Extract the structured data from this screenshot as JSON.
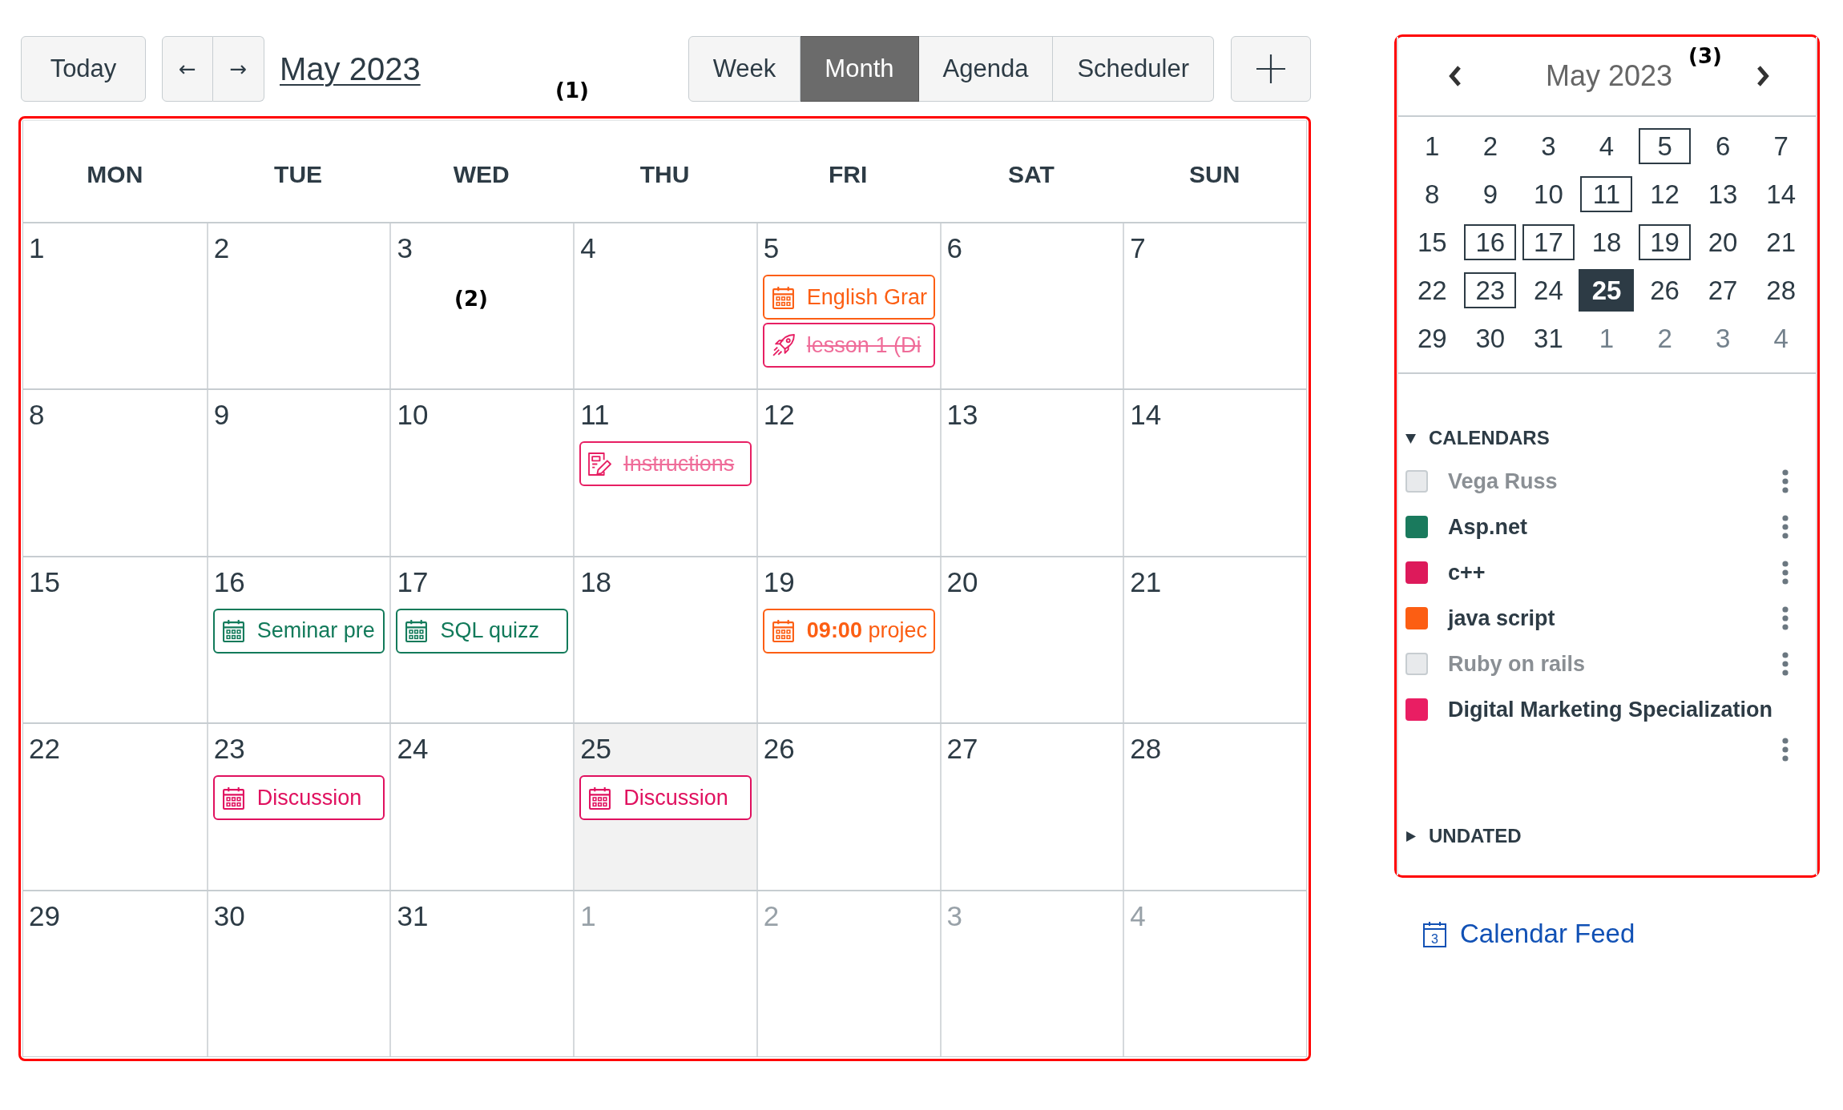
{
  "toolbar": {
    "today_button": "Today",
    "prev_button": "←",
    "next_button": "→",
    "title": "May 2023",
    "views": [
      {
        "label": "Week",
        "selected": false
      },
      {
        "label": "Month",
        "selected": true
      },
      {
        "label": "Agenda",
        "selected": false
      },
      {
        "label": "Scheduler",
        "selected": false
      }
    ]
  },
  "month_grid": {
    "weekdays": [
      "MON",
      "TUE",
      "WED",
      "THU",
      "FRI",
      "SAT",
      "SUN"
    ],
    "weeks": [
      [
        {
          "day": "1",
          "outside_month": false,
          "today": false
        },
        {
          "day": "2",
          "outside_month": false,
          "today": false
        },
        {
          "day": "3",
          "outside_month": false,
          "today": false
        },
        {
          "day": "4",
          "outside_month": false,
          "today": false
        },
        {
          "day": "5",
          "outside_month": false,
          "today": false,
          "events": [
            {
              "kind": "event",
              "title": "English Grar",
              "color": "#fc5e13",
              "completed": false
            },
            {
              "kind": "quiz",
              "title": "lesson 1 (Di",
              "color": "#e71f63",
              "completed": true
            }
          ]
        },
        {
          "day": "6",
          "outside_month": false,
          "today": false
        },
        {
          "day": "7",
          "outside_month": false,
          "today": false
        }
      ],
      [
        {
          "day": "8",
          "outside_month": false,
          "today": false
        },
        {
          "day": "9",
          "outside_month": false,
          "today": false
        },
        {
          "day": "10",
          "outside_month": false,
          "today": false
        },
        {
          "day": "11",
          "outside_month": false,
          "today": false,
          "events": [
            {
              "kind": "assignment",
              "title": "Instructions",
              "color": "#e71f63",
              "completed": true
            }
          ]
        },
        {
          "day": "12",
          "outside_month": false,
          "today": false
        },
        {
          "day": "13",
          "outside_month": false,
          "today": false
        },
        {
          "day": "14",
          "outside_month": false,
          "today": false
        }
      ],
      [
        {
          "day": "15",
          "outside_month": false,
          "today": false
        },
        {
          "day": "16",
          "outside_month": false,
          "today": false,
          "events": [
            {
              "kind": "event",
              "title": "Seminar pre",
              "color": "#127a5a",
              "completed": false
            }
          ]
        },
        {
          "day": "17",
          "outside_month": false,
          "today": false,
          "events": [
            {
              "kind": "event",
              "title": "SQL quizz",
              "color": "#127a5a",
              "completed": false
            }
          ]
        },
        {
          "day": "18",
          "outside_month": false,
          "today": false
        },
        {
          "day": "19",
          "outside_month": false,
          "today": false,
          "events": [
            {
              "kind": "event",
              "title": "**09:00** projec",
              "color": "#fc5e13",
              "completed": false
            }
          ]
        },
        {
          "day": "20",
          "outside_month": false,
          "today": false
        },
        {
          "day": "21",
          "outside_month": false,
          "today": false
        }
      ],
      [
        {
          "day": "22",
          "outside_month": false,
          "today": false
        },
        {
          "day": "23",
          "outside_month": false,
          "today": false,
          "events": [
            {
              "kind": "event",
              "title": "Discussion",
              "color": "#e0115f",
              "completed": false
            }
          ]
        },
        {
          "day": "24",
          "outside_month": false,
          "today": false
        },
        {
          "day": "25",
          "outside_month": false,
          "today": true,
          "events": [
            {
              "kind": "event",
              "title": "Discussion",
              "color": "#e0115f",
              "completed": false
            }
          ]
        },
        {
          "day": "26",
          "outside_month": false,
          "today": false
        },
        {
          "day": "27",
          "outside_month": false,
          "today": false
        },
        {
          "day": "28",
          "outside_month": false,
          "today": false
        }
      ],
      [
        {
          "day": "29",
          "outside_month": false,
          "today": false
        },
        {
          "day": "30",
          "outside_month": false,
          "today": false
        },
        {
          "day": "31",
          "outside_month": false,
          "today": false
        },
        {
          "day": "1",
          "outside_month": true,
          "today": false
        },
        {
          "day": "2",
          "outside_month": true,
          "today": false
        },
        {
          "day": "3",
          "outside_month": true,
          "today": false
        },
        {
          "day": "4",
          "outside_month": true,
          "today": false
        }
      ]
    ]
  },
  "mini_calendar": {
    "title": "May 2023",
    "days": [
      {
        "day": "1",
        "selected": false,
        "has_events": false,
        "outside_month": false
      },
      {
        "day": "2",
        "selected": false,
        "has_events": false,
        "outside_month": false
      },
      {
        "day": "3",
        "selected": false,
        "has_events": false,
        "outside_month": false
      },
      {
        "day": "4",
        "selected": false,
        "has_events": false,
        "outside_month": false
      },
      {
        "day": "5",
        "selected": false,
        "has_events": true,
        "outside_month": false
      },
      {
        "day": "6",
        "selected": false,
        "has_events": false,
        "outside_month": false
      },
      {
        "day": "7",
        "selected": false,
        "has_events": false,
        "outside_month": false
      },
      {
        "day": "8",
        "selected": false,
        "has_events": false,
        "outside_month": false
      },
      {
        "day": "9",
        "selected": false,
        "has_events": false,
        "outside_month": false
      },
      {
        "day": "10",
        "selected": false,
        "has_events": false,
        "outside_month": false
      },
      {
        "day": "11",
        "selected": false,
        "has_events": true,
        "outside_month": false
      },
      {
        "day": "12",
        "selected": false,
        "has_events": false,
        "outside_month": false
      },
      {
        "day": "13",
        "selected": false,
        "has_events": false,
        "outside_month": false
      },
      {
        "day": "14",
        "selected": false,
        "has_events": false,
        "outside_month": false
      },
      {
        "day": "15",
        "selected": false,
        "has_events": false,
        "outside_month": false
      },
      {
        "day": "16",
        "selected": false,
        "has_events": true,
        "outside_month": false
      },
      {
        "day": "17",
        "selected": false,
        "has_events": true,
        "outside_month": false
      },
      {
        "day": "18",
        "selected": false,
        "has_events": false,
        "outside_month": false
      },
      {
        "day": "19",
        "selected": false,
        "has_events": true,
        "outside_month": false
      },
      {
        "day": "20",
        "selected": false,
        "has_events": false,
        "outside_month": false
      },
      {
        "day": "21",
        "selected": false,
        "has_events": false,
        "outside_month": false
      },
      {
        "day": "22",
        "selected": false,
        "has_events": false,
        "outside_month": false
      },
      {
        "day": "23",
        "selected": false,
        "has_events": true,
        "outside_month": false
      },
      {
        "day": "24",
        "selected": false,
        "has_events": false,
        "outside_month": false
      },
      {
        "day": "25",
        "selected": true,
        "has_events": false,
        "outside_month": false
      },
      {
        "day": "26",
        "selected": false,
        "has_events": false,
        "outside_month": false
      },
      {
        "day": "27",
        "selected": false,
        "has_events": false,
        "outside_month": false
      },
      {
        "day": "28",
        "selected": false,
        "has_events": false,
        "outside_month": false
      },
      {
        "day": "29",
        "selected": false,
        "has_events": false,
        "outside_month": false
      },
      {
        "day": "30",
        "selected": false,
        "has_events": false,
        "outside_month": false
      },
      {
        "day": "31",
        "selected": false,
        "has_events": false,
        "outside_month": false
      },
      {
        "day": "1",
        "selected": false,
        "has_events": false,
        "outside_month": true
      },
      {
        "day": "2",
        "selected": false,
        "has_events": false,
        "outside_month": true
      },
      {
        "day": "3",
        "selected": false,
        "has_events": false,
        "outside_month": true
      },
      {
        "day": "4",
        "selected": false,
        "has_events": false,
        "outside_month": true
      }
    ]
  },
  "sidebar": {
    "sections": [
      {
        "title": "CALENDARS",
        "expanded": true,
        "items": [
          {
            "name": "Vega Russ",
            "checked": false
          },
          {
            "name": "Asp.net",
            "checked": true,
            "color": "#1a7a5d"
          },
          {
            "name": "c++",
            "checked": true,
            "color": "#dd1a5b"
          },
          {
            "name": "java script",
            "checked": true,
            "color": "#fc5e13"
          },
          {
            "name": "Ruby on rails",
            "checked": false
          },
          {
            "name": "Digital Marketing Specialization",
            "checked": true,
            "color": "#e91e63"
          }
        ]
      },
      {
        "title": "UNDATED",
        "expanded": false
      }
    ]
  },
  "calendar_feed": {
    "label": "Calendar Feed",
    "icon_day": "3"
  },
  "annotations": [
    {
      "label": "(1)",
      "outlined": true
    },
    {
      "label": "(2)",
      "outlined": false
    },
    {
      "label": "(3)",
      "outlined": true
    }
  ]
}
